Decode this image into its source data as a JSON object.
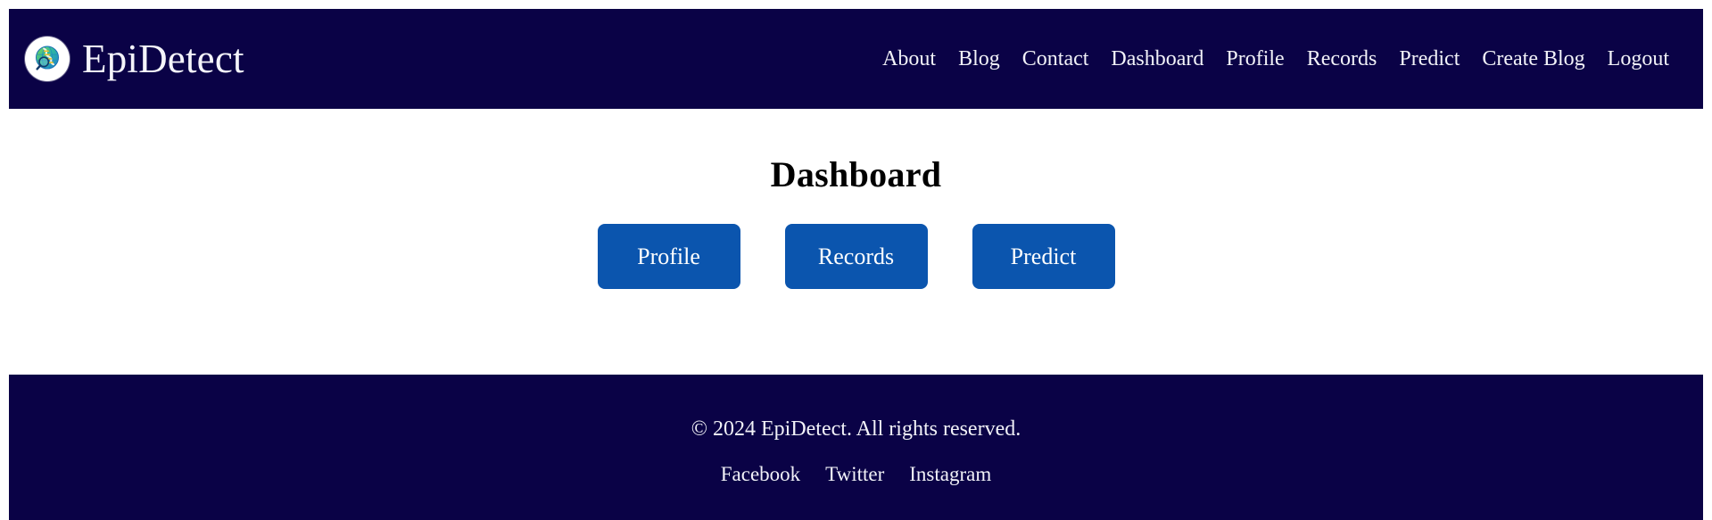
{
  "colors": {
    "header_bg": "#0a0246",
    "footer_bg": "#0a0246",
    "page_bg": "#ffffff",
    "button_blue": "#0b55ae",
    "nav_text": "#f2f2f8",
    "heading_text": "#000000"
  },
  "header": {
    "logo_icon": "globe-dna-magnifier-icon",
    "brand_name": "EpiDetect",
    "nav": [
      {
        "label": "About"
      },
      {
        "label": "Blog"
      },
      {
        "label": "Contact"
      },
      {
        "label": "Dashboard"
      },
      {
        "label": "Profile"
      },
      {
        "label": "Records"
      },
      {
        "label": "Predict"
      },
      {
        "label": "Create Blog"
      },
      {
        "label": "Logout"
      }
    ]
  },
  "main": {
    "title": "Dashboard",
    "buttons": [
      {
        "label": "Profile"
      },
      {
        "label": "Records"
      },
      {
        "label": "Predict"
      }
    ]
  },
  "footer": {
    "copyright": "© 2024 EpiDetect. All rights reserved.",
    "social": [
      {
        "label": "Facebook"
      },
      {
        "label": "Twitter"
      },
      {
        "label": "Instagram"
      }
    ]
  }
}
